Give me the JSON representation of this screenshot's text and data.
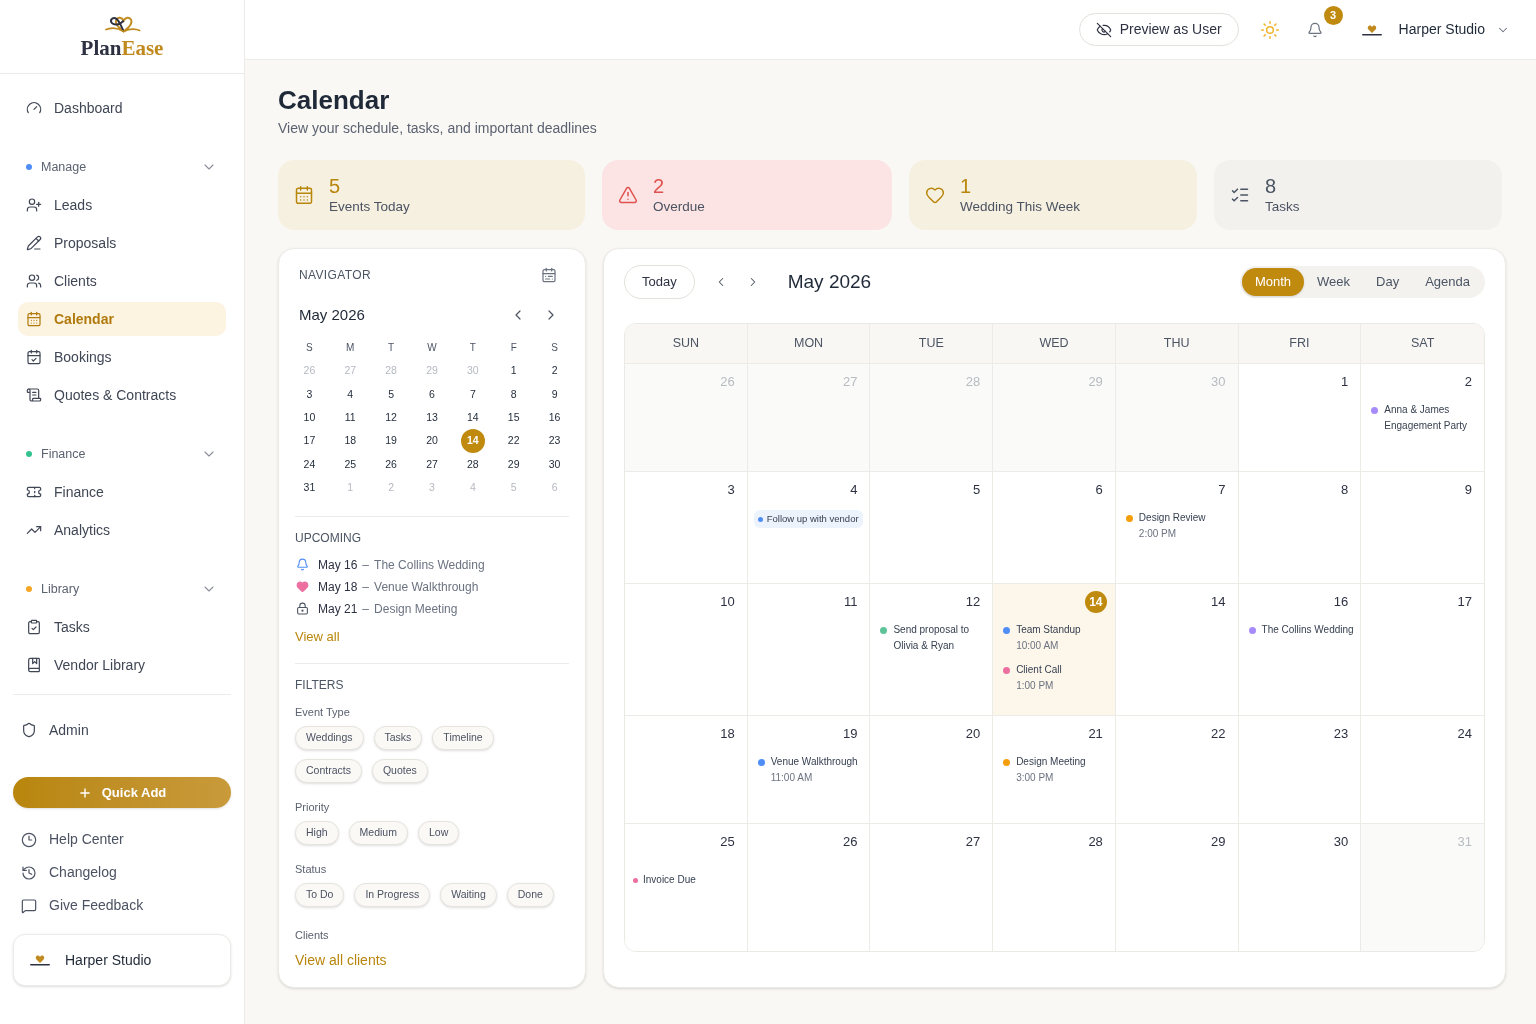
{
  "sidebar": {
    "logo": {
      "parts": [
        "Plan",
        "Ease"
      ]
    },
    "sections": [
      {
        "items": [
          {
            "label": "Dashboard",
            "selected": false
          }
        ]
      },
      {
        "title": "Manage",
        "color": "#4f8ef7",
        "expanded": true,
        "items": [
          {
            "label": "Leads",
            "selected": false
          },
          {
            "label": "Proposals",
            "selected": false
          },
          {
            "label": "Clients",
            "selected": false
          },
          {
            "label": "Calendar",
            "selected": true
          },
          {
            "label": "Bookings",
            "selected": false
          },
          {
            "label": "Quotes & Contracts",
            "selected": false
          }
        ]
      },
      {
        "title": "Finance",
        "color": "#34c38f",
        "expanded": true,
        "items": [
          {
            "label": "Finance",
            "selected": false
          },
          {
            "label": "Analytics",
            "selected": false
          }
        ]
      },
      {
        "title": "Library",
        "color": "#f5a623",
        "expanded": true,
        "items": [
          {
            "label": "Tasks",
            "selected": false
          },
          {
            "label": "Vendor Library",
            "selected": false
          }
        ]
      }
    ],
    "admin": {
      "label": "Admin",
      "selected": false
    },
    "quick_add": {
      "label": "Quick Add"
    },
    "links": [
      {
        "label": "Help Center"
      },
      {
        "label": "Changelog"
      },
      {
        "label": "Give Feedback"
      }
    ],
    "account": {
      "name": "Harper Studio"
    }
  },
  "header": {
    "preview_button": "Preview as User",
    "notification_count": "3",
    "account_name": "Harper Studio"
  },
  "page": {
    "title": "Calendar",
    "subtitle": "View your schedule, tasks, and important deadlines"
  },
  "stats": [
    {
      "kind": "events",
      "value": "5",
      "label": "Events Today"
    },
    {
      "kind": "overdue",
      "value": "2",
      "label": "Overdue"
    },
    {
      "kind": "wedding",
      "value": "1",
      "label": "Wedding This Week"
    },
    {
      "kind": "tasks",
      "value": "8",
      "label": "Tasks"
    }
  ],
  "navigator": {
    "title": "NAVIGATOR",
    "month": "May 2026",
    "weekdays": [
      "S",
      "M",
      "T",
      "W",
      "T",
      "F",
      "S"
    ],
    "weeks": [
      [
        {
          "day": "26",
          "outside": true,
          "selected": false
        },
        {
          "day": "27",
          "outside": true,
          "selected": false
        },
        {
          "day": "28",
          "outside": true,
          "selected": false
        },
        {
          "day": "29",
          "outside": true,
          "selected": false
        },
        {
          "day": "30",
          "outside": true,
          "selected": false
        },
        {
          "day": "1",
          "outside": false,
          "selected": false
        },
        {
          "day": "2",
          "outside": false,
          "selected": false
        }
      ],
      [
        {
          "day": "3",
          "outside": false,
          "selected": false
        },
        {
          "day": "4",
          "outside": false,
          "selected": false
        },
        {
          "day": "5",
          "outside": false,
          "selected": false
        },
        {
          "day": "6",
          "outside": false,
          "selected": false
        },
        {
          "day": "7",
          "outside": false,
          "selected": false
        },
        {
          "day": "8",
          "outside": false,
          "selected": false
        },
        {
          "day": "9",
          "outside": false,
          "selected": false
        }
      ],
      [
        {
          "day": "10",
          "outside": false,
          "selected": false
        },
        {
          "day": "11",
          "outside": false,
          "selected": false
        },
        {
          "day": "12",
          "outside": false,
          "selected": false
        },
        {
          "day": "13",
          "outside": false,
          "selected": false
        },
        {
          "day": "14",
          "outside": false,
          "selected": false
        },
        {
          "day": "15",
          "outside": false,
          "selected": false
        },
        {
          "day": "16",
          "outside": false,
          "selected": false
        }
      ],
      [
        {
          "day": "17",
          "outside": false,
          "selected": false
        },
        {
          "day": "18",
          "outside": false,
          "selected": false
        },
        {
          "day": "19",
          "outside": false,
          "selected": false
        },
        {
          "day": "20",
          "outside": false,
          "selected": false
        },
        {
          "day": "14",
          "outside": false,
          "selected": true
        },
        {
          "day": "22",
          "outside": false,
          "selected": false
        },
        {
          "day": "23",
          "outside": false,
          "selected": false
        }
      ],
      [
        {
          "day": "24",
          "outside": false,
          "selected": false
        },
        {
          "day": "25",
          "outside": false,
          "selected": false
        },
        {
          "day": "26",
          "outside": false,
          "selected": false
        },
        {
          "day": "27",
          "outside": false,
          "selected": false
        },
        {
          "day": "28",
          "outside": false,
          "selected": false
        },
        {
          "day": "29",
          "outside": false,
          "selected": false
        },
        {
          "day": "30",
          "outside": false,
          "selected": false
        }
      ],
      [
        {
          "day": "31",
          "outside": false,
          "selected": false
        },
        {
          "day": "1",
          "outside": true,
          "selected": false
        },
        {
          "day": "2",
          "outside": true,
          "selected": false
        },
        {
          "day": "3",
          "outside": true,
          "selected": false
        },
        {
          "day": "4",
          "outside": true,
          "selected": false
        },
        {
          "day": "5",
          "outside": true,
          "selected": false
        },
        {
          "day": "6",
          "outside": true,
          "selected": false
        }
      ]
    ]
  },
  "upcoming": {
    "title": "UPCOMING",
    "items": [
      {
        "date": "May 16",
        "separator": "–",
        "title": "The Collins Wedding"
      },
      {
        "date": "May 18",
        "separator": "–",
        "title": "Venue Walkthrough"
      },
      {
        "date": "May 21",
        "separator": "–",
        "title": "Design Meeting"
      }
    ],
    "link": "View all"
  },
  "filters": {
    "title": "FILTERS",
    "groups": [
      {
        "label": "Event Type",
        "options": [
          {
            "label": "Weddings",
            "selected": false
          },
          {
            "label": "Tasks",
            "selected": false
          },
          {
            "label": "Timeline",
            "selected": false
          },
          {
            "label": "Contracts",
            "selected": false
          },
          {
            "label": "Quotes",
            "selected": false
          }
        ]
      },
      {
        "label": "Priority",
        "options": [
          {
            "label": "High",
            "selected": false
          },
          {
            "label": "Medium",
            "selected": false
          },
          {
            "label": "Low",
            "selected": false
          }
        ]
      },
      {
        "label": "Status",
        "options": [
          {
            "label": "To Do",
            "selected": false
          },
          {
            "label": "In Progress",
            "selected": false
          },
          {
            "label": "Waiting",
            "selected": false
          },
          {
            "label": "Done",
            "selected": false
          }
        ]
      }
    ],
    "clients": {
      "label": "Clients",
      "link": "View all clients"
    }
  },
  "calendar": {
    "today_button": "Today",
    "month": "May 2026",
    "views": [
      {
        "label": "Month",
        "selected": true
      },
      {
        "label": "Week",
        "selected": false
      },
      {
        "label": "Day",
        "selected": false
      },
      {
        "label": "Agenda",
        "selected": false
      }
    ],
    "weekdays": [
      "SUN",
      "MON",
      "TUE",
      "WED",
      "THU",
      "FRI",
      "SAT"
    ],
    "weeks": [
      [
        {
          "day": "26",
          "outside": true,
          "today": false
        },
        {
          "day": "27",
          "outside": true,
          "today": false
        },
        {
          "day": "28",
          "outside": true,
          "today": false
        },
        {
          "day": "29",
          "outside": true,
          "today": false
        },
        {
          "day": "30",
          "outside": true,
          "today": false
        },
        {
          "day": "1",
          "outside": false,
          "today": false
        },
        {
          "day": "2",
          "outside": false,
          "today": false,
          "events": [
            {
              "kind": "plain",
              "title": "Anna & James Engagement Party",
              "color": "#a78bfa"
            }
          ]
        }
      ],
      [
        {
          "day": "3",
          "outside": false,
          "today": false
        },
        {
          "day": "4",
          "outside": false,
          "today": false,
          "events": [
            {
              "kind": "pill",
              "title": "Follow up with vendor",
              "color": "#4f8ef7"
            }
          ]
        },
        {
          "day": "5",
          "outside": false,
          "today": false
        },
        {
          "day": "6",
          "outside": false,
          "today": false
        },
        {
          "day": "7",
          "outside": false,
          "today": false,
          "events": [
            {
              "kind": "plain",
              "title": "Design Review",
              "time": "2:00 PM",
              "color": "#f59e0b"
            }
          ]
        },
        {
          "day": "8",
          "outside": false,
          "today": false
        },
        {
          "day": "9",
          "outside": false,
          "today": false
        }
      ],
      [
        {
          "day": "10",
          "outside": false,
          "today": false
        },
        {
          "day": "11",
          "outside": false,
          "today": false
        },
        {
          "day": "12",
          "outside": false,
          "today": false,
          "events": [
            {
              "kind": "plain",
              "title": "Send proposal to Olivia & Ryan",
              "color": "#5fc39a"
            }
          ]
        },
        {
          "day": "14",
          "outside": false,
          "today": true,
          "events": [
            {
              "kind": "plain",
              "title": "Team Standup",
              "time": "10:00 AM",
              "color": "#4f8ef7"
            },
            {
              "kind": "plain",
              "title": "Client Call",
              "time": "1:00 PM",
              "color": "#ec6fa0"
            }
          ]
        },
        {
          "day": "14",
          "outside": false,
          "today": false
        },
        {
          "day": "16",
          "outside": false,
          "today": false,
          "events": [
            {
              "kind": "plain",
              "title": "The Collins Wedding",
              "color": "#a78bfa"
            }
          ]
        },
        {
          "day": "17",
          "outside": false,
          "today": false
        }
      ],
      [
        {
          "day": "18",
          "outside": false,
          "today": false
        },
        {
          "day": "19",
          "outside": false,
          "today": false,
          "events": [
            {
              "kind": "plain",
              "title": "Venue Walkthrough",
              "time": "11:00 AM",
              "color": "#4f8ef7"
            }
          ]
        },
        {
          "day": "20",
          "outside": false,
          "today": false
        },
        {
          "day": "21",
          "outside": false,
          "today": false,
          "events": [
            {
              "kind": "plain",
              "title": "Design Meeting",
              "time": "3:00 PM",
              "color": "#f59e0b"
            }
          ]
        },
        {
          "day": "22",
          "outside": false,
          "today": false
        },
        {
          "day": "23",
          "outside": false,
          "today": false
        },
        {
          "day": "24",
          "outside": false,
          "today": false
        }
      ],
      [
        {
          "day": "25",
          "outside": false,
          "today": false,
          "events": [
            {
              "kind": "compact",
              "title": "Invoice Due",
              "color": "#ec6fa0"
            }
          ]
        },
        {
          "day": "26",
          "outside": false,
          "today": false
        },
        {
          "day": "27",
          "outside": false,
          "today": false
        },
        {
          "day": "28",
          "outside": false,
          "today": false
        },
        {
          "day": "29",
          "outside": false,
          "today": false
        },
        {
          "day": "30",
          "outside": false,
          "today": false
        },
        {
          "day": "31",
          "outside": true,
          "today": false
        }
      ]
    ]
  }
}
